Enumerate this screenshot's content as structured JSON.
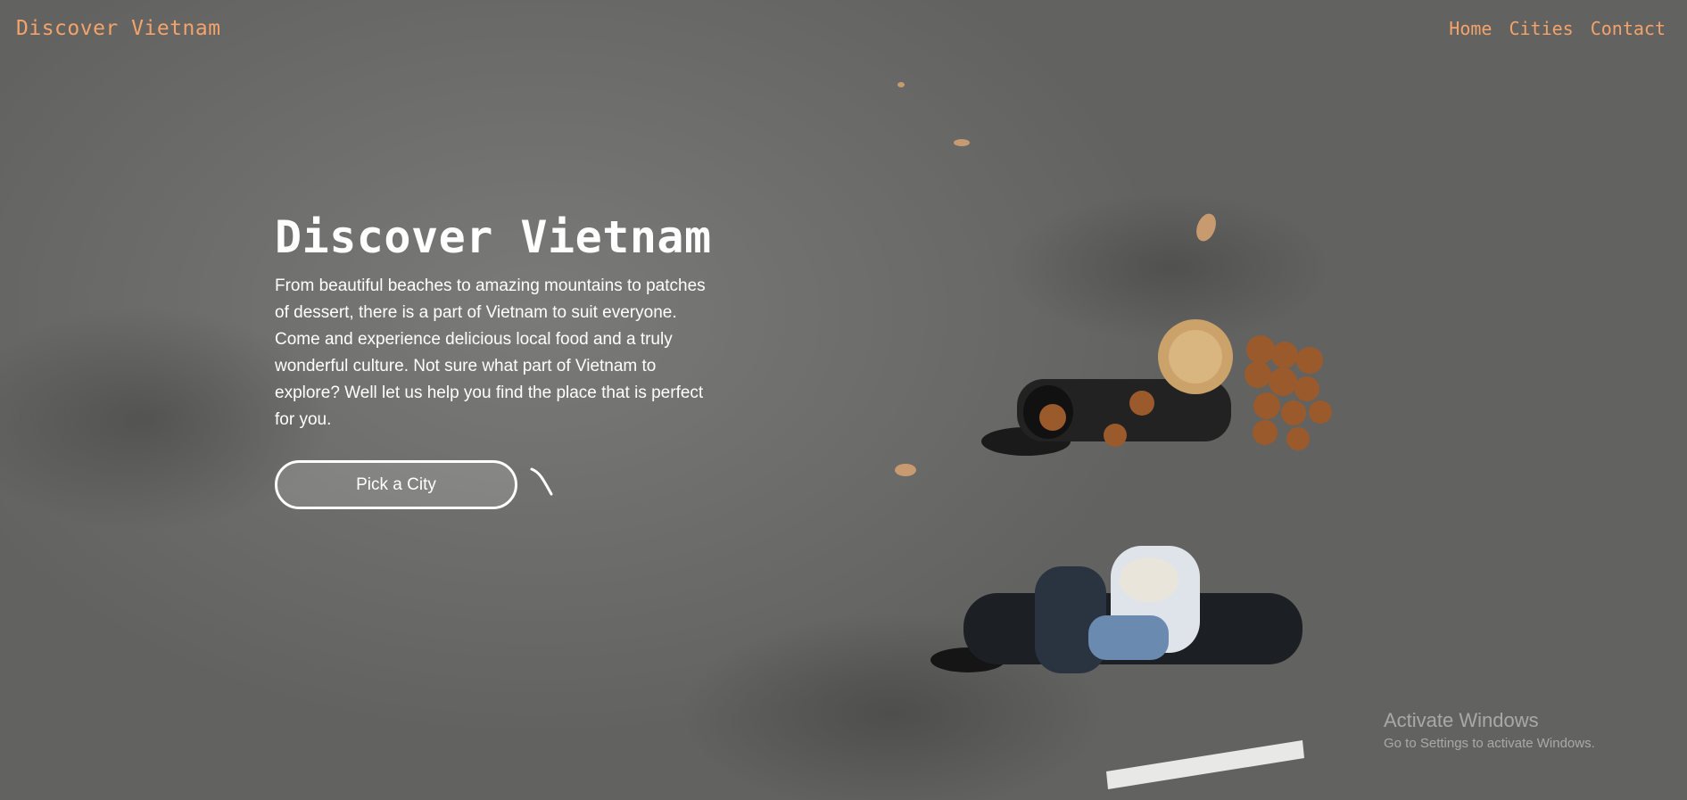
{
  "navbar": {
    "brand": "Discover Vietnam",
    "links": [
      "Home",
      "Cities",
      "Contact"
    ]
  },
  "hero": {
    "title": "Discover Vietnam",
    "description": "From beautiful beaches to amazing mountains to patches of dessert, there is a part of Vietnam to suit everyone. Come and experience delicious local food and a truly wonderful culture. Not sure what part of Vietnam to explore? Well let us help you find the place that is perfect for you.",
    "cta_label": "Pick a City"
  },
  "watermark": {
    "title": "Activate Windows",
    "subtitle": "Go to Settings to activate Windows."
  },
  "colors": {
    "accent": "#f4a36a",
    "text": "#ffffff",
    "background": "#6d6d6b"
  }
}
